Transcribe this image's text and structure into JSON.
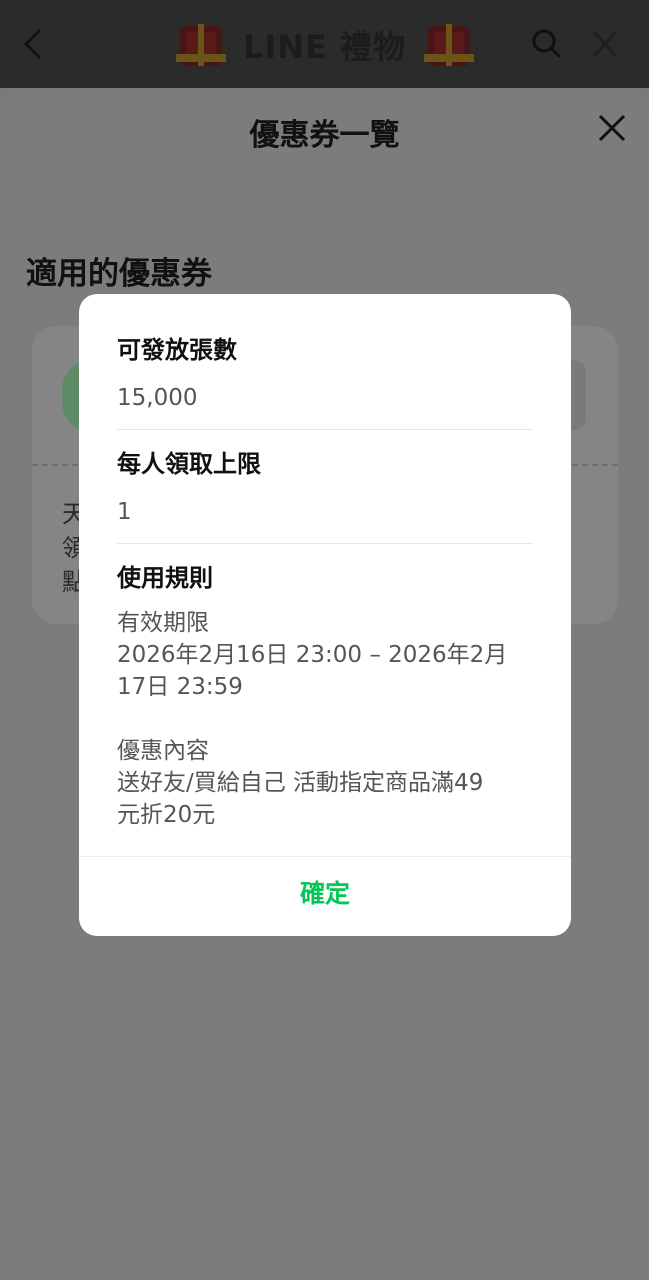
{
  "app_bar": {
    "title_brand": "LINE",
    "title_suffix": "禮物",
    "icons": [
      "back-icon",
      "search-icon",
      "close-icon",
      "gift-decoration-icon"
    ]
  },
  "sheet": {
    "title": "優惠券一覽",
    "section_title": "適用的優惠券",
    "peek_text": [
      "天",
      "領",
      "點"
    ]
  },
  "modal": {
    "issue_count_label": "可發放張數",
    "issue_count_value": "15,000",
    "per_person_label": "每人領取上限",
    "per_person_value": "1",
    "rules_label": "使用規則",
    "validity_heading": "有效期限",
    "validity_line1": "2026年2月16日 23:00 – 2026年2月",
    "validity_line2": "17日 23:59",
    "content_heading": "優惠內容",
    "content_line1": "送好友/買給自己 活動指定商品滿49",
    "content_line2": "元折20元",
    "confirm_label": "確定"
  },
  "colors": {
    "accent_green": "#06c755",
    "overlay_dim": "#7a7a7a",
    "modal_bg": "#ffffff"
  }
}
